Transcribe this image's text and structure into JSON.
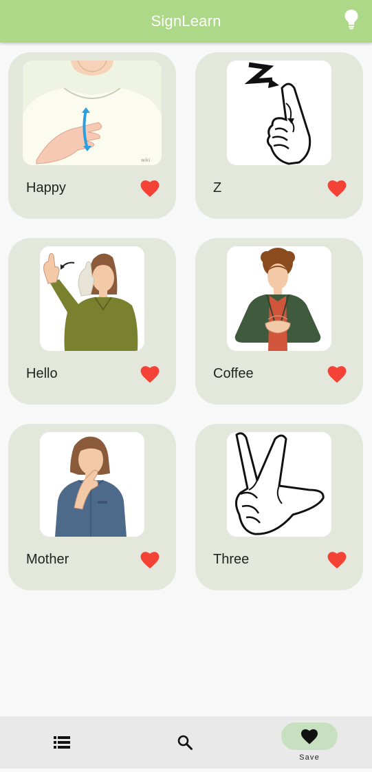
{
  "app": {
    "title": "SignLearn",
    "accent_color": "#acd888",
    "card_color": "#e4e8dc",
    "heart_color": "#f44336",
    "header_action_icon": "lightbulb-icon"
  },
  "cards": [
    {
      "label": "Happy",
      "image": "sign-happy-illustration",
      "favorite_icon": "heart-icon"
    },
    {
      "label": "Z",
      "image": "sign-letter-z-illustration",
      "favorite_icon": "heart-icon"
    },
    {
      "label": "Hello",
      "image": "sign-hello-illustration",
      "favorite_icon": "heart-icon"
    },
    {
      "label": "Coffee",
      "image": "sign-coffee-illustration",
      "favorite_icon": "heart-icon"
    },
    {
      "label": "Mother",
      "image": "sign-mother-illustration",
      "favorite_icon": "heart-icon"
    },
    {
      "label": "Three",
      "image": "sign-three-illustration",
      "favorite_icon": "heart-icon"
    }
  ],
  "bottom_nav": {
    "items": [
      {
        "icon": "list-icon",
        "label": ""
      },
      {
        "icon": "search-icon",
        "label": ""
      },
      {
        "icon": "heart-icon",
        "label": "Save",
        "selected": true
      }
    ],
    "selected_color": "#c7e1c0"
  }
}
